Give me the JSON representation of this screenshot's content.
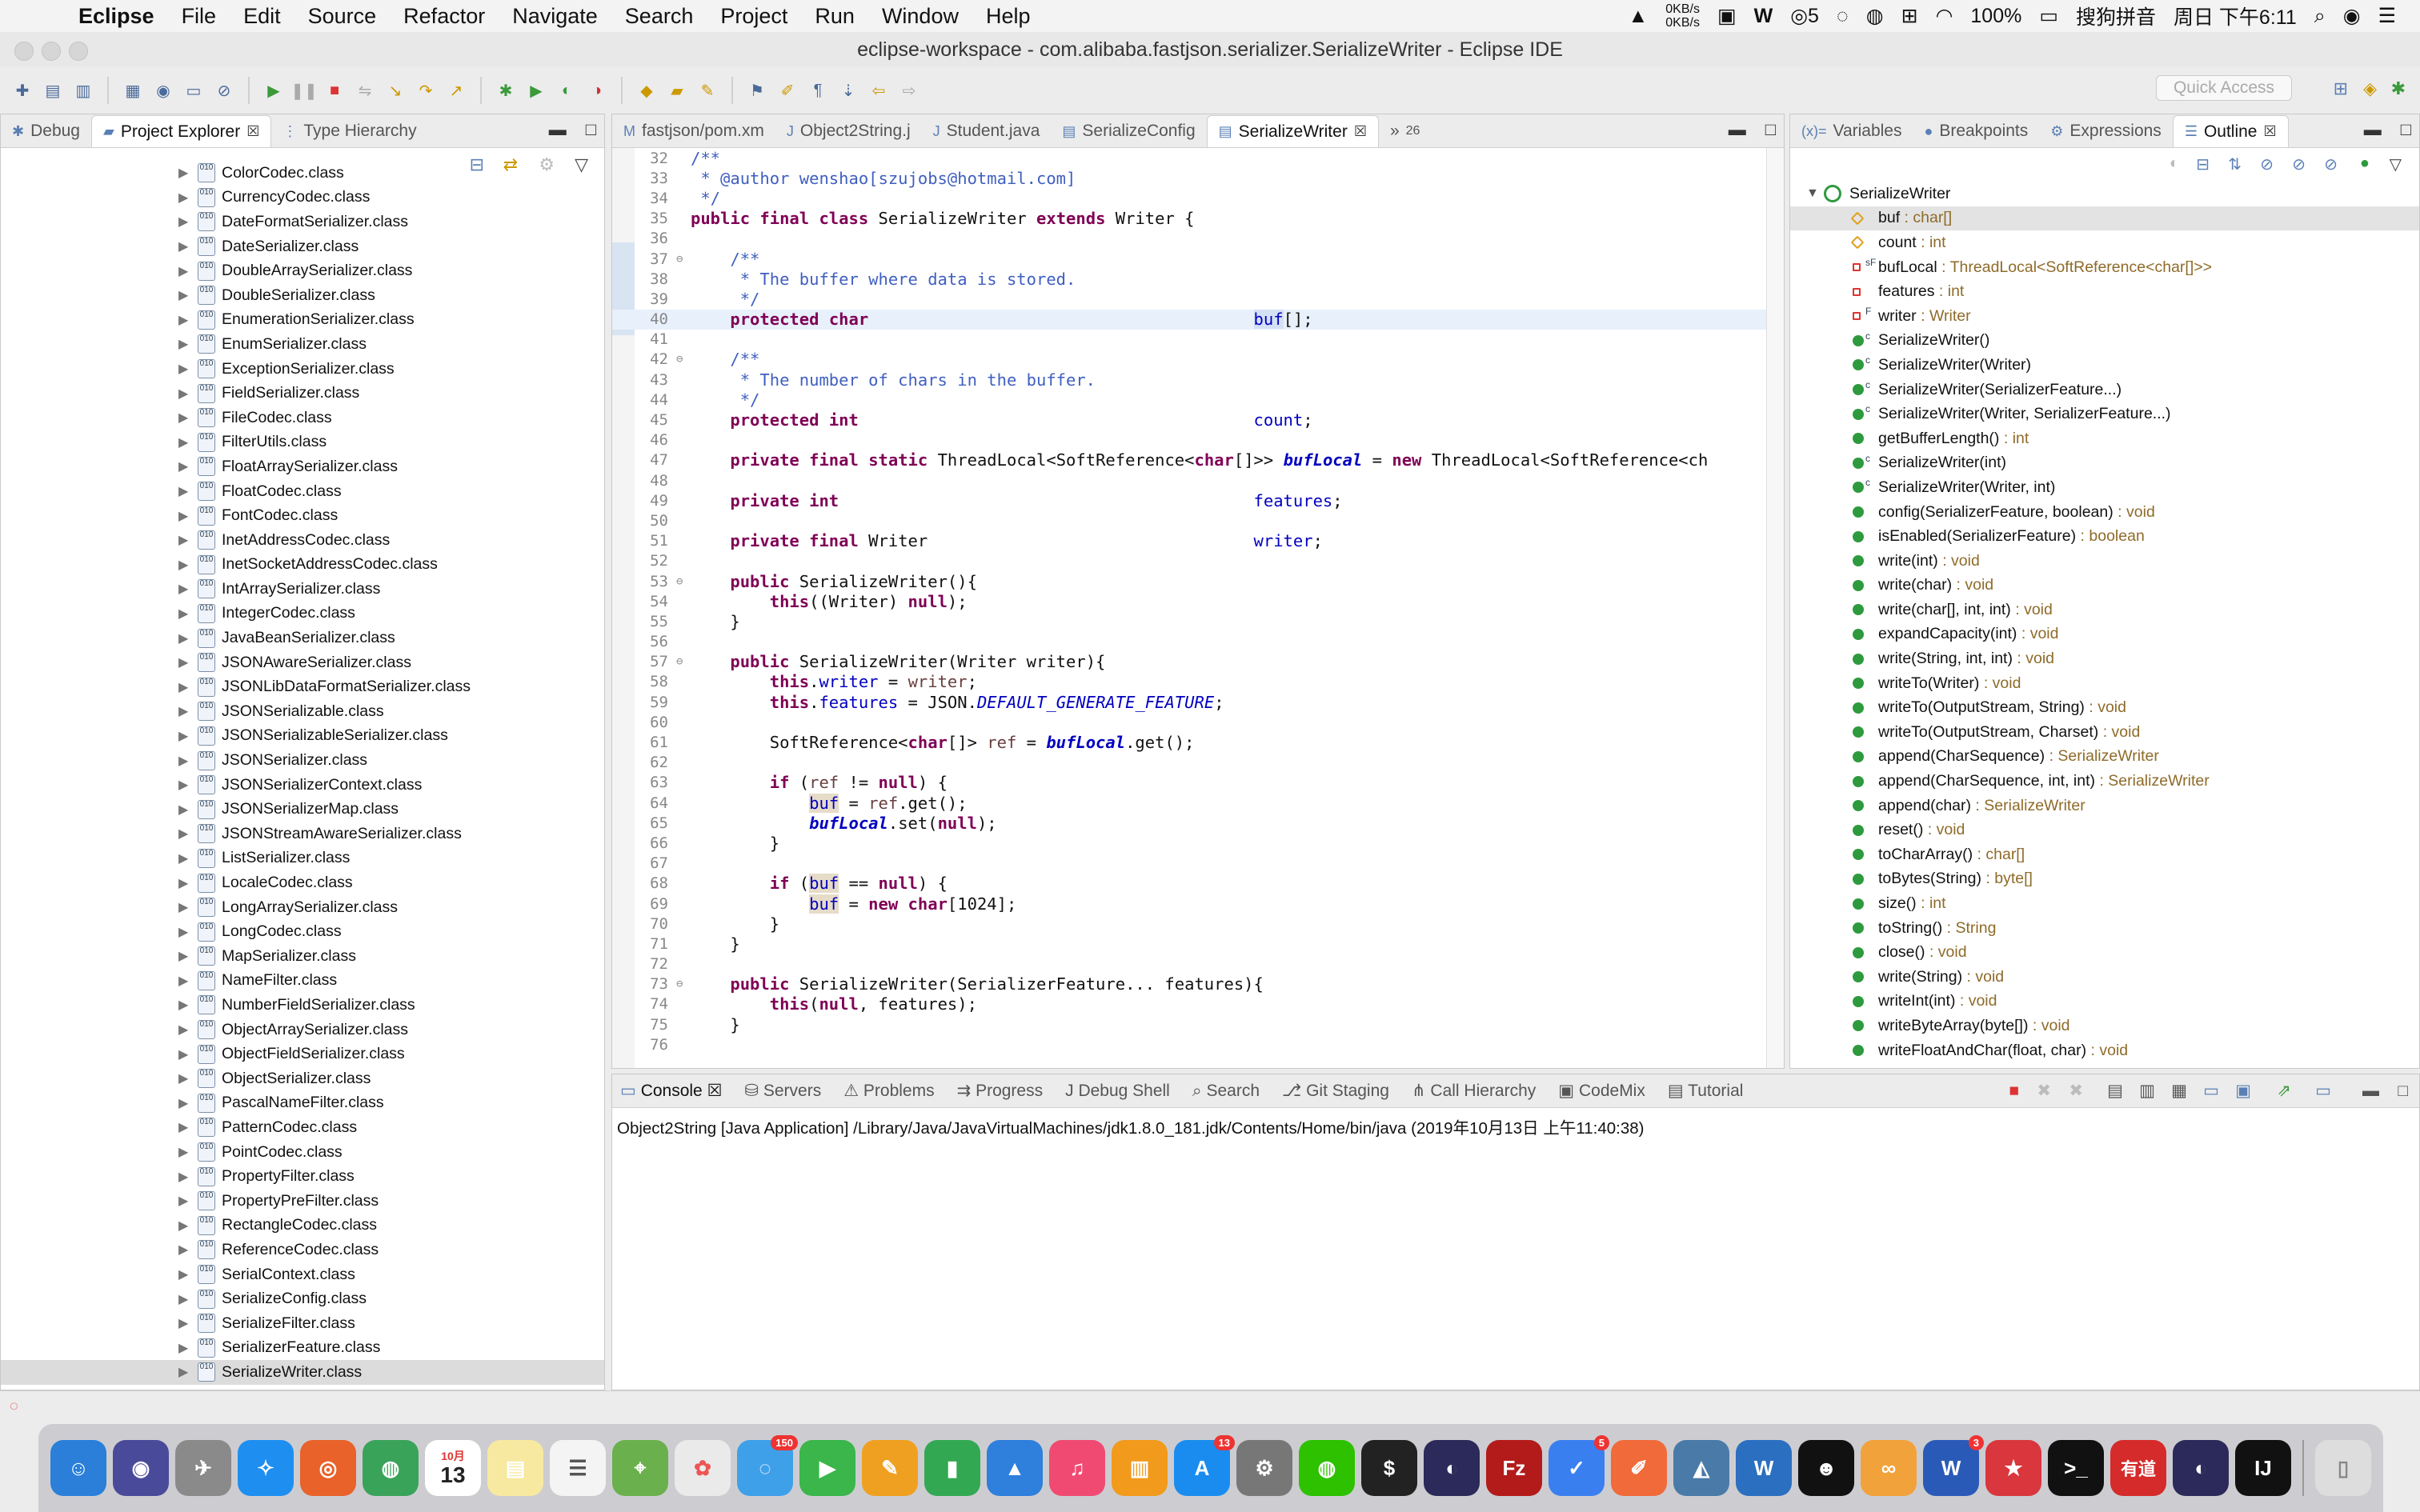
{
  "menubar": {
    "app": "Eclipse",
    "items": [
      "File",
      "Edit",
      "Source",
      "Refactor",
      "Navigate",
      "Search",
      "Project",
      "Run",
      "Window",
      "Help"
    ],
    "netspeed_up": "0KB/s",
    "netspeed_down": "0KB/s",
    "qq_count": "5",
    "battery": "100%",
    "ime": "搜狗拼音",
    "datetime": "周日 下午6:11"
  },
  "window": {
    "title": "eclipse-workspace - com.alibaba.fastjson.serializer.SerializeWriter - Eclipse IDE"
  },
  "toolbar": {
    "quick_access": "Quick Access"
  },
  "left_view": {
    "tabs": [
      "Debug",
      "Project Explorer",
      "Type Hierarchy"
    ],
    "items": [
      "ColorCodec.class",
      "CurrencyCodec.class",
      "DateFormatSerializer.class",
      "DateSerializer.class",
      "DoubleArraySerializer.class",
      "DoubleSerializer.class",
      "EnumerationSerializer.class",
      "EnumSerializer.class",
      "ExceptionSerializer.class",
      "FieldSerializer.class",
      "FileCodec.class",
      "FilterUtils.class",
      "FloatArraySerializer.class",
      "FloatCodec.class",
      "FontCodec.class",
      "InetAddressCodec.class",
      "InetSocketAddressCodec.class",
      "IntArraySerializer.class",
      "IntegerCodec.class",
      "JavaBeanSerializer.class",
      "JSONAwareSerializer.class",
      "JSONLibDataFormatSerializer.class",
      "JSONSerializable.class",
      "JSONSerializableSerializer.class",
      "JSONSerializer.class",
      "JSONSerializerContext.class",
      "JSONSerializerMap.class",
      "JSONStreamAwareSerializer.class",
      "ListSerializer.class",
      "LocaleCodec.class",
      "LongArraySerializer.class",
      "LongCodec.class",
      "MapSerializer.class",
      "NameFilter.class",
      "NumberFieldSerializer.class",
      "ObjectArraySerializer.class",
      "ObjectFieldSerializer.class",
      "ObjectSerializer.class",
      "PascalNameFilter.class",
      "PatternCodec.class",
      "PointCodec.class",
      "PropertyFilter.class",
      "PropertyPreFilter.class",
      "RectangleCodec.class",
      "ReferenceCodec.class",
      "SerialContext.class",
      "SerializeConfig.class",
      "SerializeFilter.class",
      "SerializerFeature.class",
      "SerializeWriter.class"
    ]
  },
  "editor": {
    "tabs": [
      "fastjson/pom.xm",
      "Object2String.j",
      "Student.java",
      "SerializeConfig",
      "SerializeWriter"
    ],
    "overflow": "26",
    "lines": [
      {
        "n": "32",
        "t": "/**"
      },
      {
        "n": "33",
        "t": " * @author wenshao[szujobs@hotmail.com]"
      },
      {
        "n": "34",
        "t": " */"
      },
      {
        "n": "35",
        "t": "public final class SerializeWriter extends Writer {"
      },
      {
        "n": "36",
        "t": ""
      },
      {
        "n": "37",
        "t": "    /**"
      },
      {
        "n": "38",
        "t": "     * The buffer where data is stored."
      },
      {
        "n": "39",
        "t": "     */"
      },
      {
        "n": "40",
        "t": "    protected char                                       buf[];"
      },
      {
        "n": "41",
        "t": ""
      },
      {
        "n": "42",
        "t": "    /**"
      },
      {
        "n": "43",
        "t": "     * The number of chars in the buffer."
      },
      {
        "n": "44",
        "t": "     */"
      },
      {
        "n": "45",
        "t": "    protected int                                        count;"
      },
      {
        "n": "46",
        "t": ""
      },
      {
        "n": "47",
        "t": "    private final static ThreadLocal<SoftReference<char[]>> bufLocal = new ThreadLocal<SoftReference<ch"
      },
      {
        "n": "48",
        "t": ""
      },
      {
        "n": "49",
        "t": "    private int                                          features;"
      },
      {
        "n": "50",
        "t": ""
      },
      {
        "n": "51",
        "t": "    private final Writer                                 writer;"
      },
      {
        "n": "52",
        "t": ""
      },
      {
        "n": "53",
        "t": "    public SerializeWriter(){"
      },
      {
        "n": "54",
        "t": "        this((Writer) null);"
      },
      {
        "n": "55",
        "t": "    }"
      },
      {
        "n": "56",
        "t": ""
      },
      {
        "n": "57",
        "t": "    public SerializeWriter(Writer writer){"
      },
      {
        "n": "58",
        "t": "        this.writer = writer;"
      },
      {
        "n": "59",
        "t": "        this.features = JSON.DEFAULT_GENERATE_FEATURE;"
      },
      {
        "n": "60",
        "t": ""
      },
      {
        "n": "61",
        "t": "        SoftReference<char[]> ref = bufLocal.get();"
      },
      {
        "n": "62",
        "t": ""
      },
      {
        "n": "63",
        "t": "        if (ref != null) {"
      },
      {
        "n": "64",
        "t": "            buf = ref.get();"
      },
      {
        "n": "65",
        "t": "            bufLocal.set(null);"
      },
      {
        "n": "66",
        "t": "        }"
      },
      {
        "n": "67",
        "t": ""
      },
      {
        "n": "68",
        "t": "        if (buf == null) {"
      },
      {
        "n": "69",
        "t": "            buf = new char[1024];"
      },
      {
        "n": "70",
        "t": "        }"
      },
      {
        "n": "71",
        "t": "    }"
      },
      {
        "n": "72",
        "t": ""
      },
      {
        "n": "73",
        "t": "    public SerializeWriter(SerializerFeature... features){"
      },
      {
        "n": "74",
        "t": "        this(null, features);"
      },
      {
        "n": "75",
        "t": "    }"
      },
      {
        "n": "76",
        "t": ""
      }
    ]
  },
  "right_view": {
    "tabs": [
      "Variables",
      "Breakpoints",
      "Expressions",
      "Outline"
    ],
    "root": "SerializeWriter",
    "items": [
      {
        "name": "buf",
        "type": "char[]",
        "kind": "field-protected"
      },
      {
        "name": "count",
        "type": "int",
        "kind": "field-protected"
      },
      {
        "name": "bufLocal",
        "type": "ThreadLocal<SoftReference<char[]>>",
        "kind": "field-private-static"
      },
      {
        "name": "features",
        "type": "int",
        "kind": "field-private"
      },
      {
        "name": "writer",
        "type": "Writer",
        "kind": "field-private"
      },
      {
        "name": "SerializeWriter()",
        "type": "",
        "kind": "ctor"
      },
      {
        "name": "SerializeWriter(Writer)",
        "type": "",
        "kind": "ctor"
      },
      {
        "name": "SerializeWriter(SerializerFeature...)",
        "type": "",
        "kind": "ctor"
      },
      {
        "name": "SerializeWriter(Writer, SerializerFeature...)",
        "type": "",
        "kind": "ctor"
      },
      {
        "name": "getBufferLength()",
        "type": "int",
        "kind": "method"
      },
      {
        "name": "SerializeWriter(int)",
        "type": "",
        "kind": "ctor"
      },
      {
        "name": "SerializeWriter(Writer, int)",
        "type": "",
        "kind": "ctor"
      },
      {
        "name": "config(SerializerFeature, boolean)",
        "type": "void",
        "kind": "method"
      },
      {
        "name": "isEnabled(SerializerFeature)",
        "type": "boolean",
        "kind": "method"
      },
      {
        "name": "write(int)",
        "type": "void",
        "kind": "method"
      },
      {
        "name": "write(char)",
        "type": "void",
        "kind": "method"
      },
      {
        "name": "write(char[], int, int)",
        "type": "void",
        "kind": "method"
      },
      {
        "name": "expandCapacity(int)",
        "type": "void",
        "kind": "method"
      },
      {
        "name": "write(String, int, int)",
        "type": "void",
        "kind": "method"
      },
      {
        "name": "writeTo(Writer)",
        "type": "void",
        "kind": "method"
      },
      {
        "name": "writeTo(OutputStream, String)",
        "type": "void",
        "kind": "method"
      },
      {
        "name": "writeTo(OutputStream, Charset)",
        "type": "void",
        "kind": "method"
      },
      {
        "name": "append(CharSequence)",
        "type": "SerializeWriter",
        "kind": "method"
      },
      {
        "name": "append(CharSequence, int, int)",
        "type": "SerializeWriter",
        "kind": "method"
      },
      {
        "name": "append(char)",
        "type": "SerializeWriter",
        "kind": "method"
      },
      {
        "name": "reset()",
        "type": "void",
        "kind": "method"
      },
      {
        "name": "toCharArray()",
        "type": "char[]",
        "kind": "method"
      },
      {
        "name": "toBytes(String)",
        "type": "byte[]",
        "kind": "method"
      },
      {
        "name": "size()",
        "type": "int",
        "kind": "method"
      },
      {
        "name": "toString()",
        "type": "String",
        "kind": "method"
      },
      {
        "name": "close()",
        "type": "void",
        "kind": "method"
      },
      {
        "name": "write(String)",
        "type": "void",
        "kind": "method"
      },
      {
        "name": "writeInt(int)",
        "type": "void",
        "kind": "method"
      },
      {
        "name": "writeByteArray(byte[])",
        "type": "void",
        "kind": "method"
      },
      {
        "name": "writeFloatAndChar(float, char)",
        "type": "void",
        "kind": "method"
      }
    ]
  },
  "console": {
    "tabs": [
      "Console",
      "Servers",
      "Problems",
      "Progress",
      "Debug Shell",
      "Search",
      "Git Staging",
      "Call Hierarchy",
      "CodeMix",
      "Tutorial"
    ],
    "status": "Object2String [Java Application] /Library/Java/JavaVirtualMachines/jdk1.8.0_181.jdk/Contents/Home/bin/java (2019年10月13日 上午11:40:38)"
  },
  "dock": {
    "calendar_month": "10月",
    "calendar_day": "13",
    "badge_1": "150",
    "badge_2": "13",
    "badge_3": "5",
    "badge_4": "3",
    "label_youdao": "有道",
    "label_fz": "Fz"
  },
  "colors": {
    "keyword": "#7f0055",
    "comment": "#3f5fbf",
    "field": "#0000c0",
    "type_hint": "#8e6b29",
    "outline_dot": "#2e9a3e"
  }
}
